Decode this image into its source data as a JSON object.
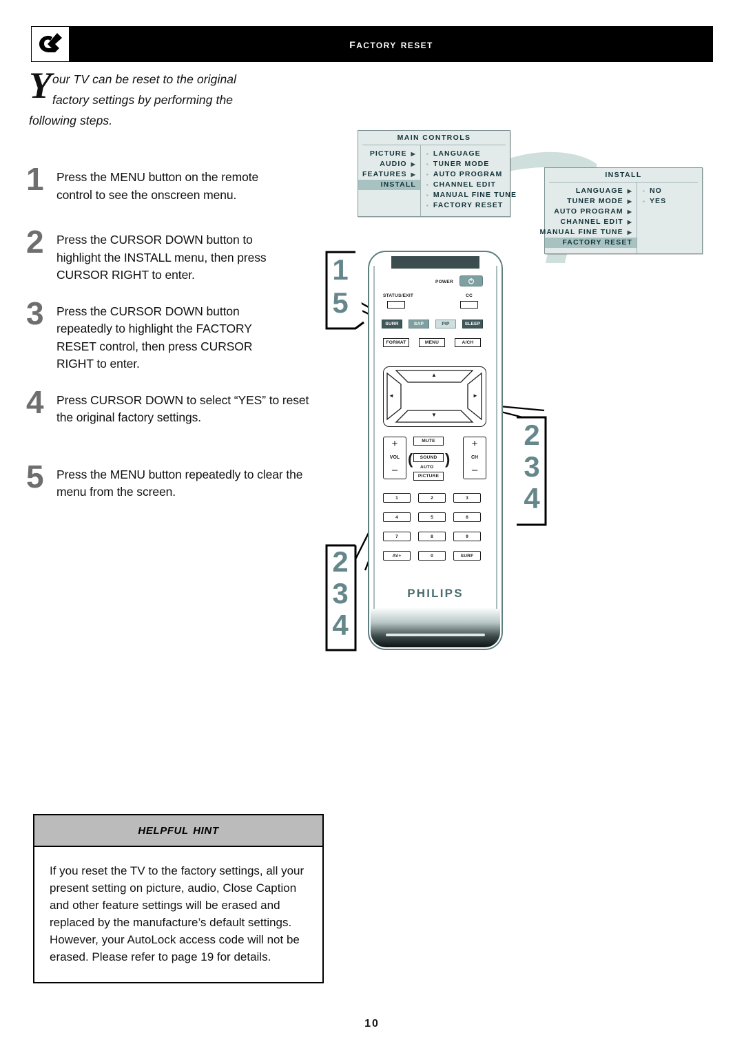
{
  "header": {
    "title": "Factory Reset",
    "logo_icon": "philips-shield-icon"
  },
  "intro": {
    "dropcap": "Y",
    "line1": "our TV can be reset to the original",
    "line2": "factory settings by performing the",
    "line3": "following steps."
  },
  "steps": [
    {
      "num": "1",
      "text": "Press the MENU button on the remote control to see the onscreen menu."
    },
    {
      "num": "2",
      "text": "Press the CURSOR DOWN button to highlight the INSTALL menu, then press CURSOR RIGHT to enter."
    },
    {
      "num": "3",
      "text": "Press the CURSOR DOWN button repeatedly to highlight the FACTORY RESET control, then press CURSOR RIGHT to enter."
    },
    {
      "num": "4",
      "text": "Press CURSOR DOWN to select “YES” to reset the original factory settings."
    },
    {
      "num": "5",
      "text": "Press the MENU button repeatedly to clear the menu from the screen."
    }
  ],
  "osd": {
    "main": {
      "title": "MAIN CONTROLS",
      "left": [
        {
          "label": "PICTURE",
          "arrow": true,
          "highlighted": false
        },
        {
          "label": "AUDIO",
          "arrow": true,
          "highlighted": false
        },
        {
          "label": "FEATURES",
          "arrow": true,
          "highlighted": false
        },
        {
          "label": "INSTALL",
          "arrow": false,
          "highlighted": true
        }
      ],
      "right": [
        {
          "label": "LANGUAGE"
        },
        {
          "label": "TUNER MODE"
        },
        {
          "label": "AUTO PROGRAM"
        },
        {
          "label": "CHANNEL EDIT"
        },
        {
          "label": "MANUAL FINE TUNE"
        },
        {
          "label": "FACTORY RESET"
        }
      ]
    },
    "install": {
      "title": "INSTALL",
      "left": [
        {
          "label": "LANGUAGE",
          "arrow": true,
          "highlighted": false
        },
        {
          "label": "TUNER MODE",
          "arrow": true,
          "highlighted": false
        },
        {
          "label": "AUTO PROGRAM",
          "arrow": true,
          "highlighted": false
        },
        {
          "label": "CHANNEL EDIT",
          "arrow": true,
          "highlighted": false
        },
        {
          "label": "MANUAL FINE TUNE",
          "arrow": true,
          "highlighted": false
        },
        {
          "label": "FACTORY RESET",
          "arrow": false,
          "highlighted": true
        }
      ],
      "right": [
        {
          "label": "NO"
        },
        {
          "label": "YES"
        }
      ]
    }
  },
  "remote": {
    "brand": "PHILIPS",
    "power_label": "POWER",
    "power_icon": "power-icon",
    "status_label": "STATUS/EXIT",
    "cc_label": "CC",
    "row_mode": [
      {
        "label": "SURR",
        "style": "dark"
      },
      {
        "label": "SAP",
        "style": "mid"
      },
      {
        "label": "PIP",
        "style": "lite"
      },
      {
        "label": "SLEEP",
        "style": "dark"
      }
    ],
    "row_nav": [
      {
        "label": "FORMAT"
      },
      {
        "label": "MENU"
      },
      {
        "label": "A/CH"
      }
    ],
    "dpad": {
      "up": "▲",
      "down": "▼",
      "left": "◄",
      "right": "►"
    },
    "vol": {
      "plus": "+",
      "minus": "–",
      "name": "VOL"
    },
    "ch": {
      "plus": "+",
      "minus": "–",
      "name": "CH"
    },
    "mute": "MUTE",
    "sound": "SOUND",
    "auto": "AUTO",
    "picture": "PICTURE",
    "keypad": [
      "1",
      "2",
      "3",
      "4",
      "5",
      "6",
      "7",
      "8",
      "9",
      "AV+",
      "0",
      "SURF"
    ]
  },
  "callouts": {
    "top_left": [
      "1",
      "5"
    ],
    "right": [
      "2",
      "3",
      "4"
    ],
    "bottom_left": [
      "2",
      "3",
      "4"
    ]
  },
  "hint": {
    "title": "Helpful Hint",
    "body": "If you reset the TV to the factory settings, all your present setting on picture, audio, Close Caption and other feature settings will be erased and replaced by the manufacture’s default settings. However, your AutoLock access code will not be erased. Please refer to page 19 for details."
  },
  "page_number": "10",
  "colors": {
    "header_bar": "#000000",
    "step_number": "#6e6e6e",
    "osd_bg": "#e3eaea",
    "osd_highlight": "#a8c2c2",
    "osd_text": "#12343a",
    "callout_number": "#65878b",
    "hint_header": "#bbbbbb",
    "swoosh": "#cfdfdc"
  }
}
